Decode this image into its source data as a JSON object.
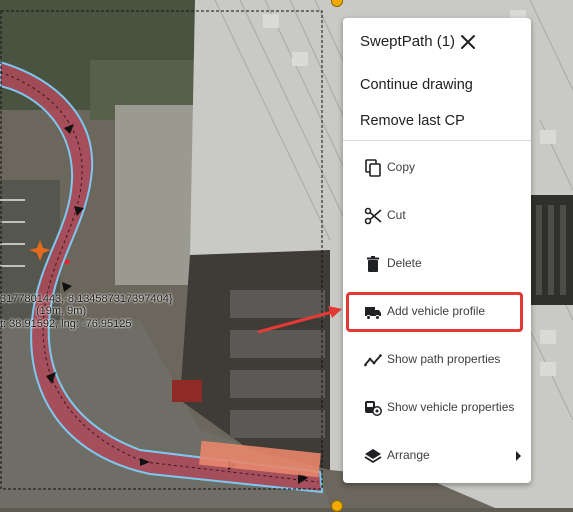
{
  "map": {
    "coord_label_1": "3177801443,-8.134587317397404}",
    "coord_label_2": "(19m, 9m)",
    "coord_label_3": "t: 38.91592, lng: -76.95125"
  },
  "menu": {
    "title": "SweptPath (1)",
    "continue_drawing": "Continue drawing",
    "remove_last_cp": "Remove last CP",
    "items": [
      {
        "label": "Copy",
        "icon": "copy-icon"
      },
      {
        "label": "Cut",
        "icon": "scissors-icon"
      },
      {
        "label": "Delete",
        "icon": "trash-icon"
      },
      {
        "label": "Add vehicle profile",
        "icon": "truck-icon"
      },
      {
        "label": "Show path properties",
        "icon": "path-chart-icon"
      },
      {
        "label": "Show vehicle properties",
        "icon": "vehicle-properties-icon"
      },
      {
        "label": "Arrange",
        "icon": "layers-icon"
      }
    ]
  },
  "colors": {
    "path_fill": "#b04a5a",
    "path_outline": "#7ec8f0",
    "highlight": "#e53935",
    "vehicle": "#e8866a"
  }
}
